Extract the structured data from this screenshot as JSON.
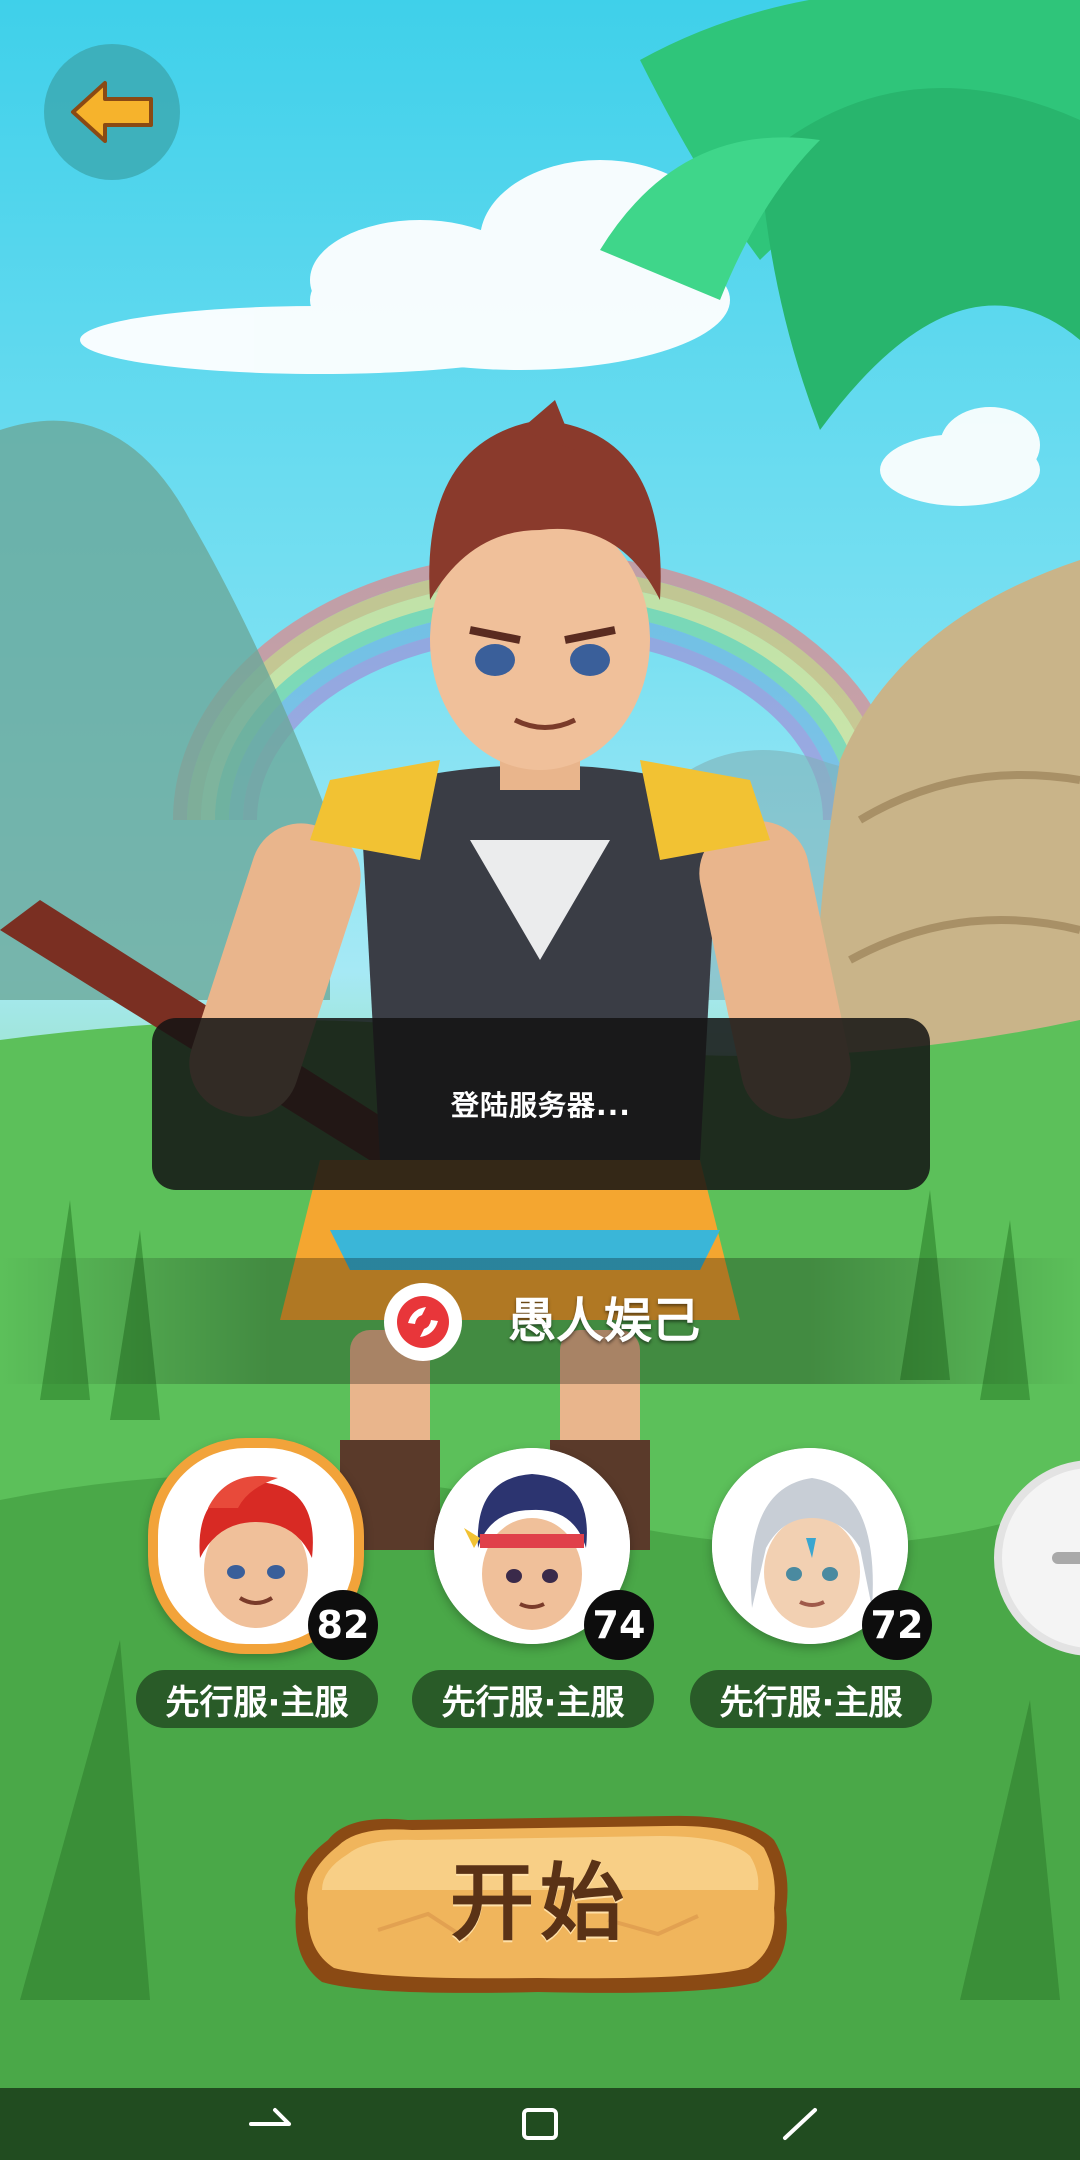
{
  "toast": {
    "message": "登陆服务器..."
  },
  "account": {
    "name": "愚人娱己",
    "icon": "network-logo-icon"
  },
  "roles": [
    {
      "level": "82",
      "server": "先行服·主服",
      "selected": true,
      "hair": "red"
    },
    {
      "level": "74",
      "server": "先行服·主服",
      "selected": false,
      "hair": "navy"
    },
    {
      "level": "72",
      "server": "先行服·主服",
      "selected": false,
      "hair": "silver"
    }
  ],
  "start_button": {
    "label": "开始"
  },
  "icons": {
    "back": "back-arrow-icon",
    "add_role": "plus-icon",
    "nav_back": "nav-back-icon",
    "nav_home": "nav-home-icon",
    "nav_recents": "nav-recents-icon"
  },
  "colors": {
    "sky": "#3fd0ea",
    "grass": "#5bc25a",
    "selected_ring": "#f2a33a",
    "start_button": "#f0b55c",
    "start_text": "#5a3216"
  }
}
